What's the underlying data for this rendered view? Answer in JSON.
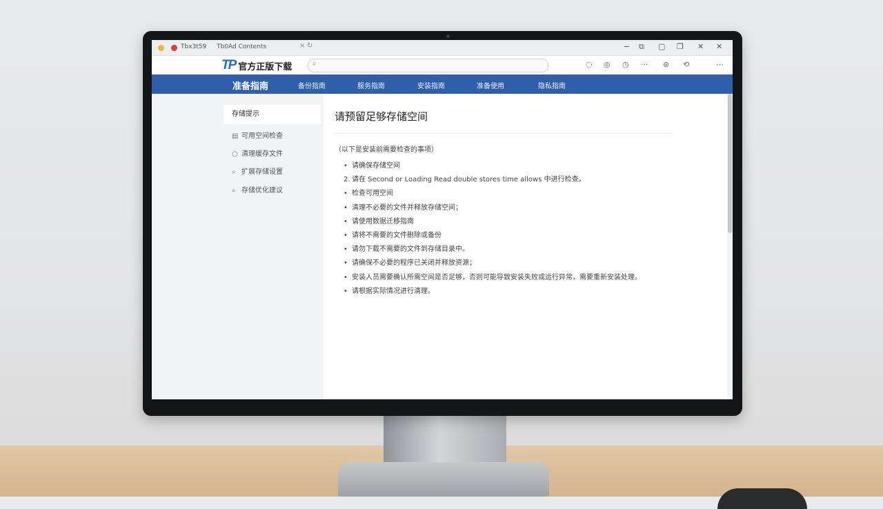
{
  "browser": {
    "tab_title_parts": [
      "Tbx3t59",
      "Tb0Ad Contents"
    ],
    "window_controls": [
      "minimize",
      "restore",
      "maximize",
      "close"
    ]
  },
  "header": {
    "logo_mark": "TP",
    "logo_text": "官方正版下载",
    "search_placeholder": ""
  },
  "nav": {
    "items": [
      "准备指南",
      "备份指南",
      "服务指南",
      "安装指南",
      "准备使用",
      "隐私指南"
    ]
  },
  "sidebar": {
    "heading": "存储提示",
    "items": [
      "可用空间检查",
      "清理缓存文件",
      "扩展存储设置",
      "存储优化建议"
    ]
  },
  "content": {
    "title": "请预留足够存储空间",
    "intro": "（以下是安装前需要检查的事项）",
    "items": [
      {
        "bullet": "•",
        "text": "请确保存储空间"
      },
      {
        "bullet": "2.",
        "text": "请在 Second or Loading Read double stores time allows 中进行检查。"
      },
      {
        "bullet": "•",
        "text": "检查可用空间"
      },
      {
        "bullet": "•",
        "text": "清理不必要的文件并释放存储空间；"
      },
      {
        "bullet": "•",
        "text": "请使用数据迁移指南"
      },
      {
        "bullet": "•",
        "text": "请将不需要的文件删除或备份"
      },
      {
        "bullet": "•",
        "text": "请勿下载不需要的文件到存储目录中。"
      },
      {
        "bullet": "•",
        "text": "请确保不必要的程序已关闭并释放资源；"
      },
      {
        "bullet": "•",
        "text": "安装人员需要确认所需空间是否足够，否则可能导致安装失败或运行异常，需要重新安装处理。"
      },
      {
        "bullet": "•",
        "text": "请根据实际情况进行清理。"
      }
    ]
  },
  "colors": {
    "nav_bg": "#2e5fa8",
    "logo_blue": "#1f6bd0",
    "sidebar_bg": "#f2f3f5"
  }
}
